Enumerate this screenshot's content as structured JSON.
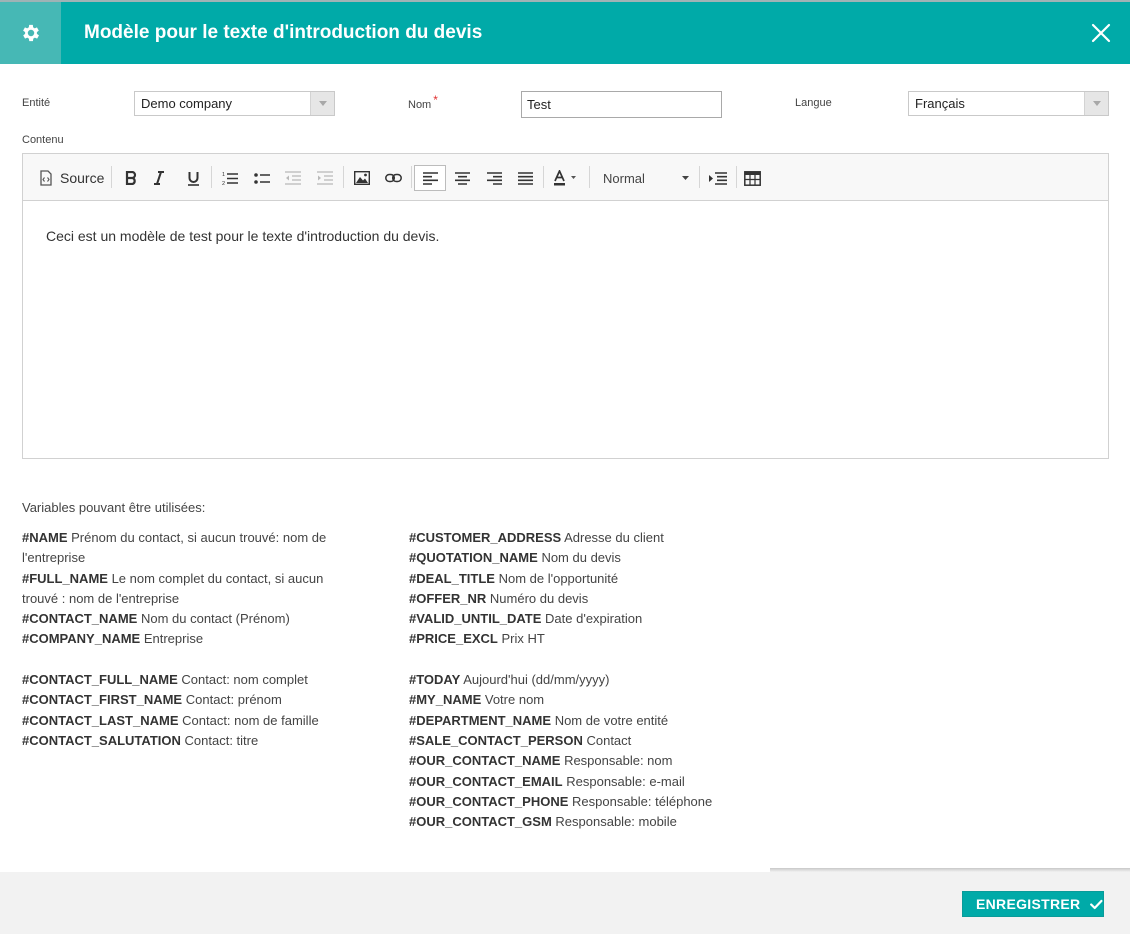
{
  "header": {
    "title": "Modèle pour le texte d'introduction du devis",
    "icon": "gear-icon",
    "close_icon": "close-icon"
  },
  "form": {
    "entity_label": "Entité",
    "entity_value": "Demo company",
    "name_label": "Nom",
    "name_required_marker": "*",
    "name_value": "Test",
    "language_label": "Langue",
    "language_value": "Français",
    "content_label": "Contenu"
  },
  "toolbar": {
    "source_label": "Source",
    "format_value": "Normal"
  },
  "editor": {
    "content": "Ceci est un modèle de test pour le texte d'introduction du devis."
  },
  "variables": {
    "title": "Variables pouvant être utilisées:",
    "left_group_1": [
      {
        "name": "#NAME",
        "desc": "Prénom du contact, si aucun trouvé: nom de l'entreprise"
      },
      {
        "name": "#FULL_NAME",
        "desc": "Le nom complet du contact, si aucun trouvé : nom de l'entreprise"
      },
      {
        "name": "#CONTACT_NAME",
        "desc": "Nom du contact (Prénom)"
      },
      {
        "name": "#COMPANY_NAME",
        "desc": "Entreprise"
      }
    ],
    "left_group_2": [
      {
        "name": "#CONTACT_FULL_NAME",
        "desc": "Contact: nom complet"
      },
      {
        "name": "#CONTACT_FIRST_NAME",
        "desc": "Contact: prénom"
      },
      {
        "name": "#CONTACT_LAST_NAME",
        "desc": "Contact: nom de famille"
      },
      {
        "name": "#CONTACT_SALUTATION",
        "desc": "Contact: titre"
      }
    ],
    "right_group_1": [
      {
        "name": "#CUSTOMER_ADDRESS",
        "desc": "Adresse du client"
      },
      {
        "name": "#QUOTATION_NAME",
        "desc": "Nom du devis"
      },
      {
        "name": "#DEAL_TITLE",
        "desc": "Nom de l'opportunité"
      },
      {
        "name": "#OFFER_NR",
        "desc": "Numéro du devis"
      },
      {
        "name": "#VALID_UNTIL_DATE",
        "desc": "Date d'expiration"
      },
      {
        "name": "#PRICE_EXCL",
        "desc": "Prix HT"
      }
    ],
    "right_group_2": [
      {
        "name": "#TODAY",
        "desc": "Aujourd'hui (dd/mm/yyyy)"
      },
      {
        "name": "#MY_NAME",
        "desc": "Votre nom"
      },
      {
        "name": "#DEPARTMENT_NAME",
        "desc": "Nom de votre entité"
      },
      {
        "name": "#SALE_CONTACT_PERSON",
        "desc": "Contact"
      },
      {
        "name": "#OUR_CONTACT_NAME",
        "desc": "Responsable: nom"
      },
      {
        "name": "#OUR_CONTACT_EMAIL",
        "desc": "Responsable: e-mail"
      },
      {
        "name": "#OUR_CONTACT_PHONE",
        "desc": "Responsable: téléphone"
      },
      {
        "name": "#OUR_CONTACT_GSM",
        "desc": "Responsable: mobile"
      }
    ]
  },
  "footer": {
    "save_label": "ENREGISTRER"
  },
  "colors": {
    "accent": "#00aaa8",
    "header_icon_bg": "#46b8b5",
    "required": "#e03030"
  }
}
